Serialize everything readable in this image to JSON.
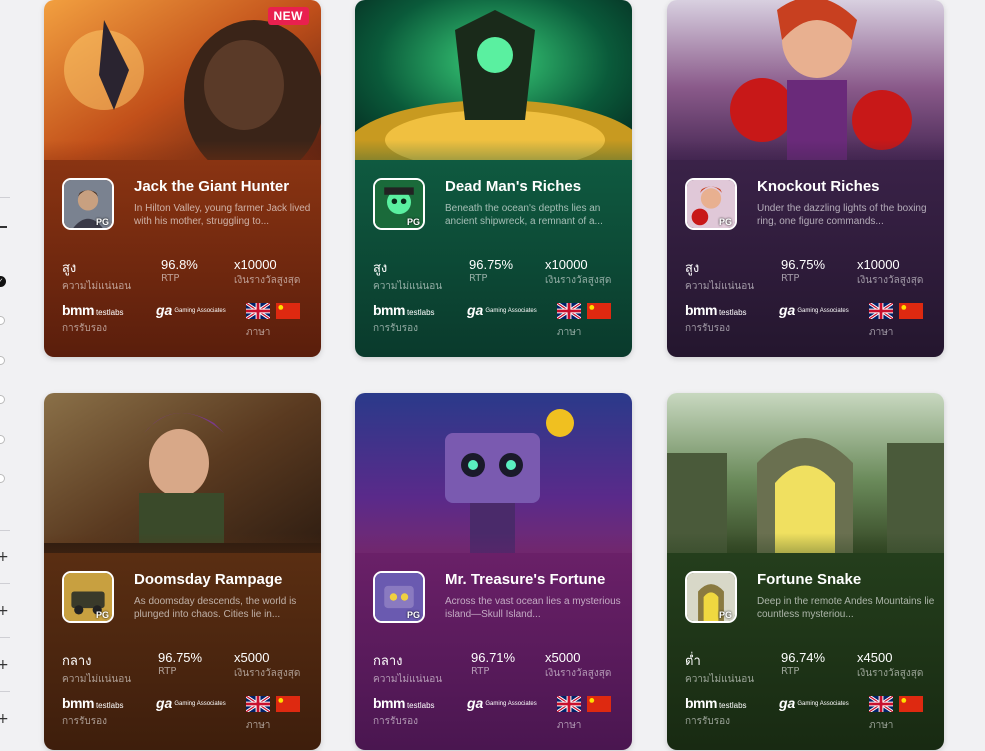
{
  "labels": {
    "volatility": "ความไม่แน่นอน",
    "rtp": "RTP",
    "max_win": "เงินรางวัลสูงสุด",
    "certified": "การรับรอง",
    "language": "ภาษา",
    "bmm_logo": "bmm",
    "bmm_sub": "testlabs",
    "ga_logo": "ga",
    "ga_sub": "Gaming Associates",
    "pg_badge": "PG"
  },
  "games": [
    {
      "title": "Jack the Giant Hunter",
      "description": "In Hilton Valley, young farmer Jack lived with his mother, struggling to...",
      "volatility": "สูง",
      "rtp": "96.8%",
      "max_win": "x10000",
      "badge": "NEW",
      "bg": "#6a2510",
      "accent": "#b8461a"
    },
    {
      "title": "Dead Man's Riches",
      "description": "Beneath the ocean's depths lies an ancient shipwreck, a remnant of a...",
      "volatility": "สูง",
      "rtp": "96.75%",
      "max_win": "x10000",
      "bg": "#0f4a3a",
      "accent": "#1d7a50"
    },
    {
      "title": "Knockout Riches",
      "description": "Under the dazzling lights of the boxing ring, one figure commands...",
      "volatility": "สูง",
      "rtp": "96.75%",
      "max_win": "x10000",
      "bg": "#2e1a3e",
      "accent": "#6a2a4a"
    },
    {
      "title": "Doomsday Rampage",
      "description": "As doomsday descends, the world is plunged into chaos. Cities lie in...",
      "volatility": "กลาง",
      "rtp": "96.75%",
      "max_win": "x5000",
      "bg": "#4a2510",
      "accent": "#8a4a1a"
    },
    {
      "title": "Mr. Treasure's Fortune",
      "description": "Across the vast ocean lies a mysterious island—Skull Island...",
      "volatility": "กลาง",
      "rtp": "96.71%",
      "max_win": "x5000",
      "bg": "#4a1a55",
      "accent": "#8a2a7a"
    },
    {
      "title": "Fortune Snake",
      "description": "Deep in the remote Andes Mountains lie countless mysteriou...",
      "volatility": "ต่ำ",
      "rtp": "96.74%",
      "max_win": "x4500",
      "bg": "#1e3518",
      "accent": "#3a5a22"
    }
  ]
}
